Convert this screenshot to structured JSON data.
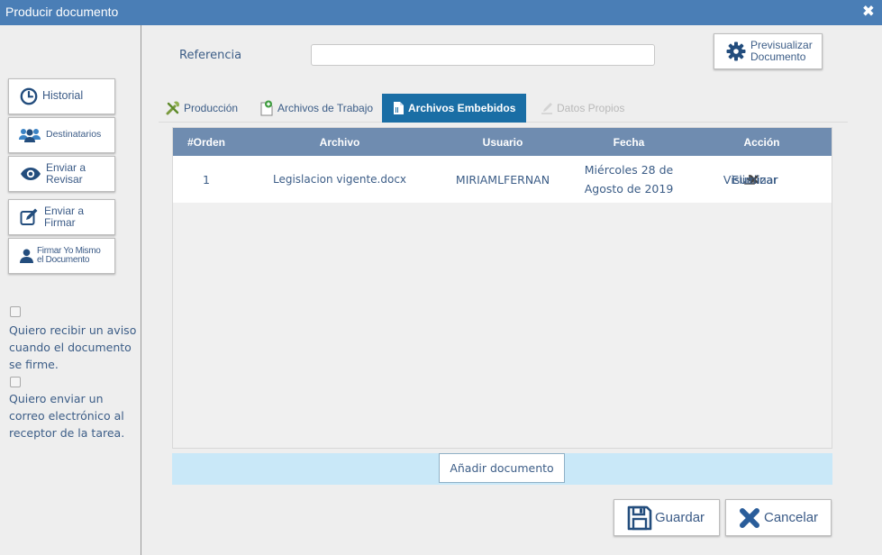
{
  "window": {
    "title": "Producir documento",
    "close_glyph": "✖"
  },
  "sidebar": {
    "buttons": {
      "historial": "Historial",
      "destinatarios": "Destinatarios",
      "enviar_revisar": [
        "Enviar a",
        "Revisar"
      ],
      "enviar_firmar": [
        "Enviar a",
        "Firmar"
      ],
      "firmar_yo": [
        "Firmar Yo Mismo",
        "el Documento"
      ]
    },
    "checkboxes": [
      {
        "label": "Quiero recibir un aviso cuando el documento se firme.",
        "checked": false
      },
      {
        "label": "Quiero enviar un correo electrónico al receptor de la tarea.",
        "checked": false
      }
    ]
  },
  "form": {
    "referencia_label": "Referencia",
    "referencia_value": "",
    "preview_button": [
      "Previsualizar",
      "Documento"
    ]
  },
  "tabs": [
    {
      "label": "Producción",
      "icon": "tools-icon",
      "state": "normal"
    },
    {
      "label": "Archivos de Trabajo",
      "icon": "add-file-icon",
      "state": "normal"
    },
    {
      "label": "Archivos Embebidos",
      "icon": "file-icon",
      "state": "active"
    },
    {
      "label": "Datos Propios",
      "icon": "edit-icon",
      "state": "disabled"
    }
  ],
  "table": {
    "columns": [
      "#Orden",
      "Archivo",
      "Usuario",
      "Fecha",
      "Acción"
    ],
    "rows": [
      {
        "orden": "1",
        "archivo": "Legislacion vigente.docx",
        "usuario": "MIRIAMLFERNAN",
        "fecha": [
          "Miércoles 28 de",
          "Agosto de 2019"
        ],
        "acciones": {
          "visualizar": "Visualizar",
          "eliminar": "Eliminar"
        }
      }
    ]
  },
  "add_document_button": "Añadir documento",
  "footer": {
    "guardar": "Guardar",
    "cancelar": "Cancelar"
  },
  "colors": {
    "titlebar": "#4a7eb6",
    "active_tab": "#1a6ea5",
    "table_header": "#6f8cb0",
    "add_bar": "#c9e8f8",
    "text_blue": "#3c5d87",
    "icon_dark": "#234d7d",
    "icon_blue": "#3b82c4",
    "cancel_icon": "#2a5d9a"
  }
}
